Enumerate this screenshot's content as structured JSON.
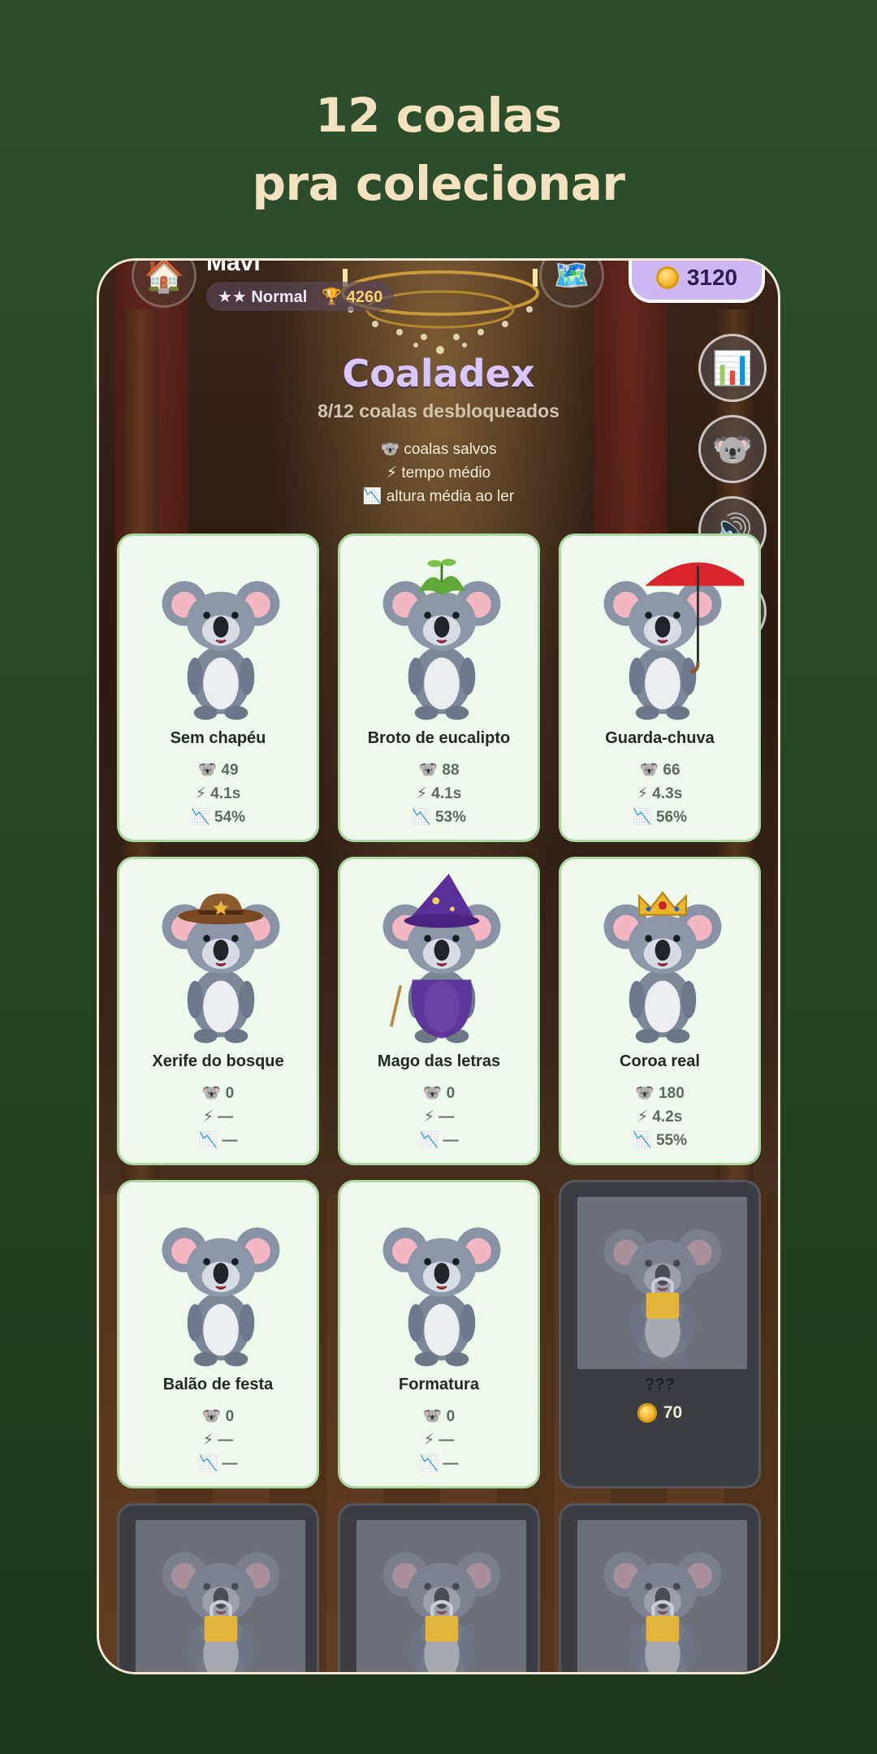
{
  "headline": {
    "line1": "12 coalas",
    "line2": "pra colecionar"
  },
  "topbar": {
    "player_name": "Mavi",
    "rank": "★★ Normal",
    "trophy_icon": "🏆",
    "trophies": "4260",
    "coins": "3120"
  },
  "side_buttons": [
    {
      "name": "stats",
      "icon": "📊"
    },
    {
      "name": "koala",
      "icon": "🐨"
    },
    {
      "name": "sound",
      "icon": "🔊"
    },
    {
      "name": "language",
      "icon": "🇧🇷"
    }
  ],
  "collection": {
    "title": "Coaladex",
    "progress": "8/12 coalas desbloqueados",
    "legend": {
      "saved": "🐨 coalas salvos",
      "time": "⚡ tempo médio",
      "height": "📉 altura média ao ler"
    },
    "cards": [
      {
        "name": "Sem chapéu",
        "accessory": "none",
        "saved": "🐨 49",
        "time": "⚡ 4.1s",
        "height": "📉 54%"
      },
      {
        "name": "Broto de eucalipto",
        "accessory": "leaves",
        "saved": "🐨 88",
        "time": "⚡ 4.1s",
        "height": "📉 53%"
      },
      {
        "name": "Guarda-chuva",
        "accessory": "umbrella",
        "saved": "🐨 66",
        "time": "⚡ 4.3s",
        "height": "📉 56%"
      },
      {
        "name": "Xerife do bosque",
        "accessory": "cowboy-hat",
        "saved": "🐨 0",
        "time": "⚡ —",
        "height": "📉 —"
      },
      {
        "name": "Mago das letras",
        "accessory": "wizard",
        "saved": "🐨 0",
        "time": "⚡ —",
        "height": "📉 —"
      },
      {
        "name": "Coroa real",
        "accessory": "crown",
        "saved": "🐨 180",
        "time": "⚡ 4.2s",
        "height": "📉 55%"
      },
      {
        "name": "Balão de festa",
        "accessory": "none",
        "saved": "🐨 0",
        "time": "⚡ —",
        "height": "📉 —"
      },
      {
        "name": "Formatura",
        "accessory": "none",
        "saved": "🐨 0",
        "time": "⚡ —",
        "height": "📉 —"
      },
      {
        "name": "???",
        "locked": true,
        "price": "70"
      }
    ]
  },
  "colors": {
    "card_bg": "#eff8ec",
    "card_border": "#a9d8a0",
    "coin_pill": "#cdb8f5",
    "headline": "#f3e2bf"
  }
}
